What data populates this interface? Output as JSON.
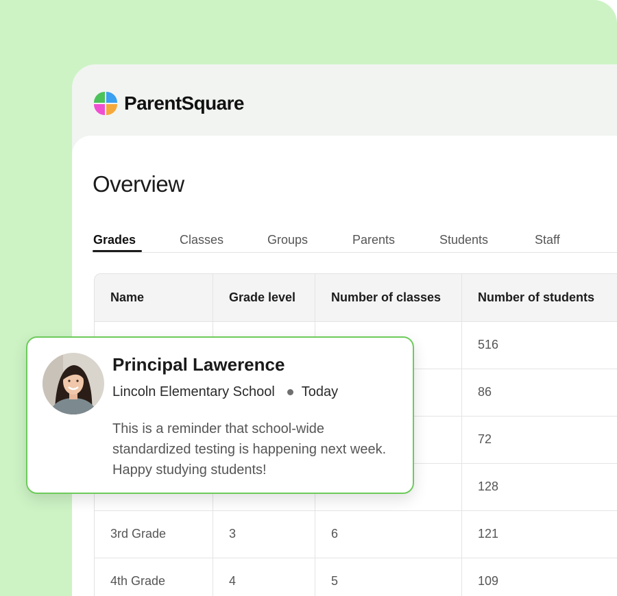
{
  "app": {
    "brand": "ParentSquare"
  },
  "page": {
    "title": "Overview"
  },
  "tabs": [
    {
      "label": "Grades",
      "active": true
    },
    {
      "label": "Classes",
      "active": false
    },
    {
      "label": "Groups",
      "active": false
    },
    {
      "label": "Parents",
      "active": false
    },
    {
      "label": "Students",
      "active": false
    },
    {
      "label": "Staff",
      "active": false
    }
  ],
  "table": {
    "columns": [
      "Name",
      "Grade level",
      "Number of classes",
      "Number of students"
    ],
    "rows": [
      [
        "",
        "",
        "",
        "516"
      ],
      [
        "",
        "",
        "",
        "86"
      ],
      [
        "",
        "",
        "",
        "72"
      ],
      [
        "",
        "",
        "",
        "128"
      ],
      [
        "3rd Grade",
        "3",
        "6",
        "121"
      ],
      [
        "4th Grade",
        "4",
        "5",
        "109"
      ]
    ]
  },
  "notification": {
    "sender": "Principal Lawerence",
    "school": "Lincoln Elementary School",
    "time": "Today",
    "message": "This is a reminder that school-wide standardized testing is happening next week. Happy studying students!"
  },
  "colors": {
    "background": "#cdf3c5",
    "card_border": "#6ccb5a",
    "logo_green": "#4cc25a",
    "logo_blue": "#3aa0f0",
    "logo_pink": "#f04fd2",
    "logo_orange": "#f6a93b"
  },
  "icons": {
    "logo": "parentsquare-logo-icon",
    "avatar": "user-avatar"
  }
}
